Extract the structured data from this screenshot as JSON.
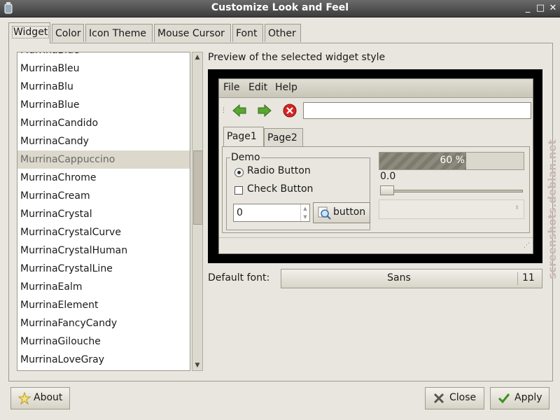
{
  "window": {
    "title": "Customize Look and Feel"
  },
  "tabs": [
    "Widget",
    "Color",
    "Icon Theme",
    "Mouse Cursor",
    "Font",
    "Other"
  ],
  "theme_list": {
    "partial_top": "MurrinaBlue",
    "items": [
      "MurrinaBleu",
      "MurrinaBlu",
      "MurrinaBlue",
      "MurrinaCandido",
      "MurrinaCandy",
      "MurrinaCappuccino",
      "MurrinaChrome",
      "MurrinaCream",
      "MurrinaCrystal",
      "MurrinaCrystalCurve",
      "MurrinaCrystalHuman",
      "MurrinaCrystalLine",
      "MurrinaEalm",
      "MurrinaElement",
      "MurrinaFancyCandy",
      "MurrinaGilouche",
      "MurrinaLoveGray"
    ],
    "selected": "MurrinaCappuccino"
  },
  "preview": {
    "label": "Preview of the selected widget style",
    "menus": [
      "File",
      "Edit",
      "Help"
    ],
    "tabs": [
      "Page1",
      "Page2"
    ],
    "demo_title": "Demo",
    "radio_label": "Radio Button",
    "check_label": "Check Button",
    "spin_value": "0",
    "button_label": "button",
    "progress": {
      "fraction": 0.6,
      "text": "60 %"
    },
    "slider_value": "0.0"
  },
  "default_font": {
    "label": "Default font:",
    "name": "Sans",
    "size": "11"
  },
  "buttons": {
    "about": "About",
    "close": "Close",
    "apply": "Apply"
  },
  "watermark": "screenshots.debian.net"
}
